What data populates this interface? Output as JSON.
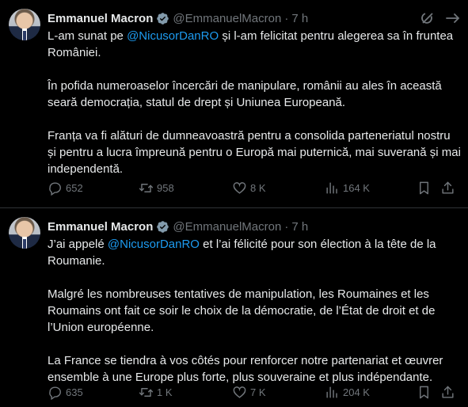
{
  "tweets": [
    {
      "author": {
        "name": "Emmanuel Macron",
        "handle": "@EmmanuelMacron",
        "time": "7 h"
      },
      "paragraphs": [
        {
          "pre": "L-am sunat pe ",
          "mention": "@NicusorDanRO",
          "post": " și l-am felicitat pentru alegerea sa în fruntea României."
        },
        {
          "text": "În pofida numeroaselor încercări de manipulare, românii au ales în această seară democrația, statul de drept și Uniunea Europeană."
        },
        {
          "text": "Franța va fi alături de dumneavoastră pentru a consolida parteneriatul nostru și pentru a lucra împreună pentru o Europă mai puternică, mai suverană și mai independentă."
        }
      ],
      "stats": {
        "replies": "652",
        "reposts": "958",
        "likes": "8 K",
        "views": "164 K"
      }
    },
    {
      "author": {
        "name": "Emmanuel Macron",
        "handle": "@EmmanuelMacron",
        "time": "7 h"
      },
      "paragraphs": [
        {
          "pre": "J’ai appelé ",
          "mention": "@NicusorDanRO",
          "post": " et l’ai félicité pour son élection à la tête de la Roumanie."
        },
        {
          "text": "Malgré les nombreuses tentatives de manipulation, les Roumaines et les Roumains ont fait ce soir le choix de la démocratie, de l’État de droit et de l’Union européenne."
        },
        {
          "text": "La France se tiendra à vos côtés pour renforcer notre partenariat et œuvrer ensemble à une Europe plus forte, plus souveraine et plus indépendante."
        }
      ],
      "stats": {
        "replies": "635",
        "reposts": "1 K",
        "likes": "7 K",
        "views": "204 K"
      }
    }
  ],
  "colors": {
    "background": "#000000",
    "text": "#e7e9ea",
    "muted": "#71767b",
    "link": "#1d9bf0",
    "verified": "#829aab",
    "divider": "#2f3336"
  },
  "icons": [
    "verified-badge-icon",
    "grok-icon",
    "more-icon",
    "reply-icon",
    "repost-icon",
    "like-icon",
    "views-icon",
    "bookmark-icon",
    "share-icon"
  ]
}
